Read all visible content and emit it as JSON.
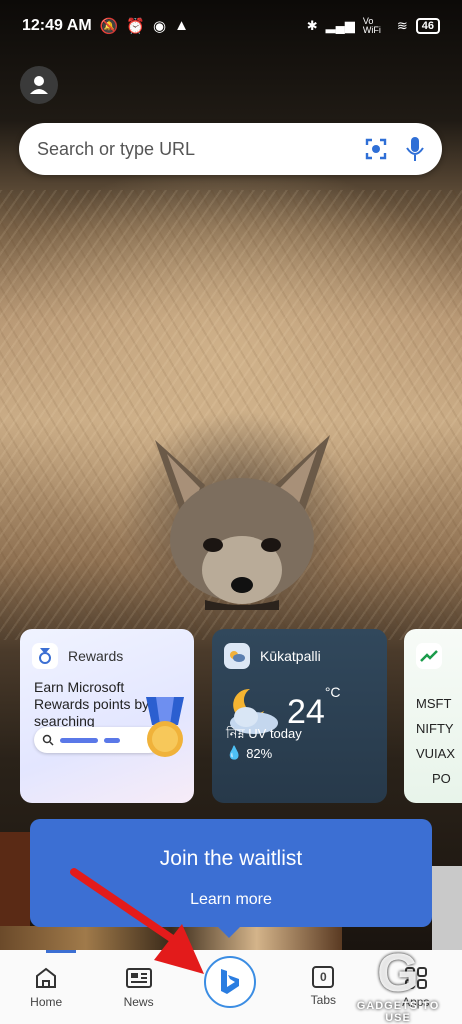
{
  "status_bar": {
    "time": "12:49 AM",
    "battery": "46",
    "vowifi": "Vo WiFi"
  },
  "search": {
    "placeholder": "Search or type URL"
  },
  "cards": {
    "rewards": {
      "title": "Rewards",
      "text": "Earn Microsoft Rewards points by searching"
    },
    "weather": {
      "location": "Kūkatpalli",
      "temperature": "24",
      "unit": "°C",
      "uv": "নিম্ন UV today",
      "humidity": "82%"
    },
    "stocks": {
      "items": [
        "MSFT",
        "NIFTY",
        "VUIAX",
        "PO"
      ]
    }
  },
  "waitlist": {
    "title": "Join the waitlist",
    "link": "Learn more"
  },
  "nav": {
    "home": "Home",
    "news": "News",
    "tabs_count": "0",
    "tabs": "Tabs",
    "apps": "Apps"
  },
  "watermark": {
    "text": "GADGETS TO USE"
  },
  "colors": {
    "accent": "#3c6fd3",
    "bing": "#3b8de3",
    "arrow": "#e31b1b"
  }
}
